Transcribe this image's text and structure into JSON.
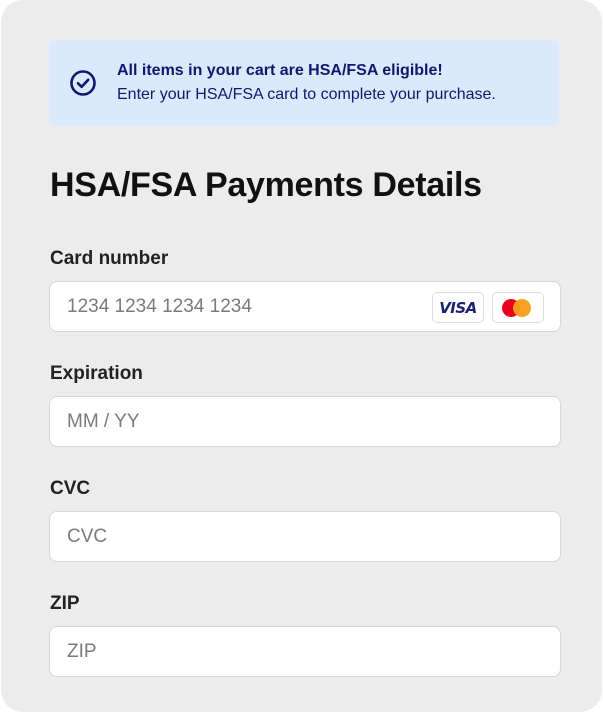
{
  "banner": {
    "icon": "check-circle-icon",
    "title": "All items in your cart are HSA/FSA eligible!",
    "subtitle": "Enter your HSA/FSA card to complete your purchase."
  },
  "page_title": "HSA/FSA Payments Details",
  "fields": {
    "card_number": {
      "label": "Card number",
      "placeholder": "1234 1234 1234 1234",
      "value": ""
    },
    "expiration": {
      "label": "Expiration",
      "placeholder": "MM / YY",
      "value": ""
    },
    "cvc": {
      "label": "CVC",
      "placeholder": "CVC",
      "value": ""
    },
    "zip": {
      "label": "ZIP",
      "placeholder": "ZIP",
      "value": ""
    }
  },
  "card_brands": {
    "visa": "VISA",
    "mastercard": "mastercard-logo"
  },
  "colors": {
    "banner_bg": "#dbe9fc",
    "banner_text": "#14166e",
    "panel_bg": "#ececec"
  }
}
